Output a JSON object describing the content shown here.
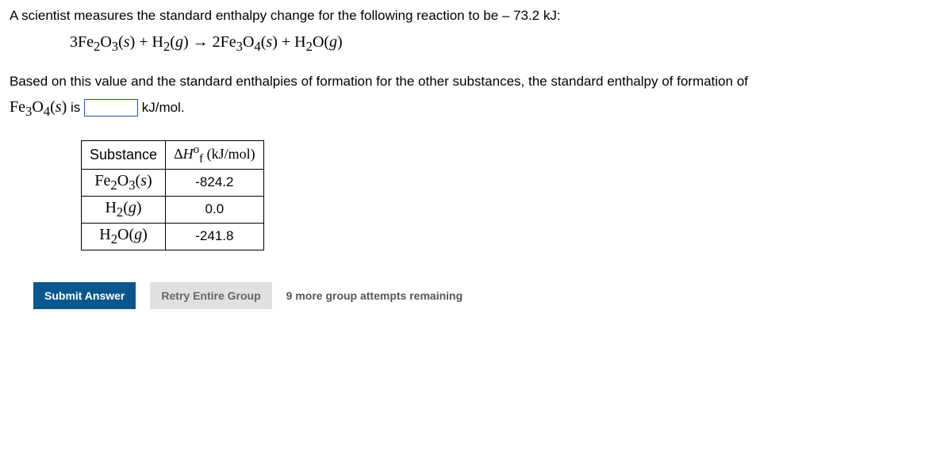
{
  "intro": "A scientist measures the standard enthalpy change for the following reaction to be – 73.2 kJ:",
  "equation_html": "3Fe<sub>2</sub>O<sub>3</sub>(<i>s</i>) + H<sub>2</sub>(<i>g</i>) → 2Fe<sub>3</sub>O<sub>4</sub>(<i>s</i>) + H<sub>2</sub>O(<i>g</i>)",
  "question_pre": "Based on this value and the standard enthalpies of formation for the other substances, the standard enthalpy of formation of",
  "question_chem_html": "Fe<sub>3</sub>O<sub>4</sub>(<i>s</i>)",
  "question_mid": " is ",
  "question_post": " kJ/mol.",
  "answer_value": "",
  "table": {
    "header_substance": "Substance",
    "header_value_html": "Δ<i>H</i><sup>o</sup><sub>f</sub> (kJ/mol)",
    "rows": [
      {
        "substance_html": "Fe<sub>2</sub>O<sub>3</sub>(<i>s</i>)",
        "value": "-824.2"
      },
      {
        "substance_html": "H<sub>2</sub>(<i>g</i>)",
        "value": "0.0"
      },
      {
        "substance_html": "H<sub>2</sub>O(<i>g</i>)",
        "value": "-241.8"
      }
    ]
  },
  "buttons": {
    "submit": "Submit Answer",
    "retry": "Retry Entire Group"
  },
  "attempts": "9 more group attempts remaining"
}
